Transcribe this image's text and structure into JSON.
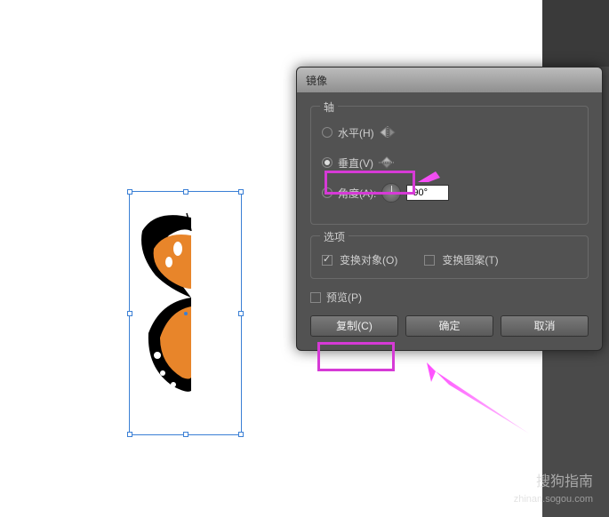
{
  "dialog": {
    "title": "镜像",
    "axis": {
      "legend": "轴",
      "horizontal": {
        "label": "水平(H)",
        "checked": false
      },
      "vertical": {
        "label": "垂直(V)",
        "checked": true
      },
      "angle": {
        "label": "角度(A):",
        "value": "90°",
        "checked": false
      }
    },
    "options": {
      "legend": "选项",
      "transform_object": {
        "label": "变换对象(O)",
        "checked": true
      },
      "transform_pattern": {
        "label": "变换图案(T)",
        "checked": false
      }
    },
    "preview": {
      "label": "预览(P)",
      "checked": false
    },
    "buttons": {
      "copy": "复制(C)",
      "ok": "确定",
      "cancel": "取消"
    }
  },
  "watermark": {
    "main": "搜狗指南",
    "sub": "zhinan.sogou.com"
  }
}
